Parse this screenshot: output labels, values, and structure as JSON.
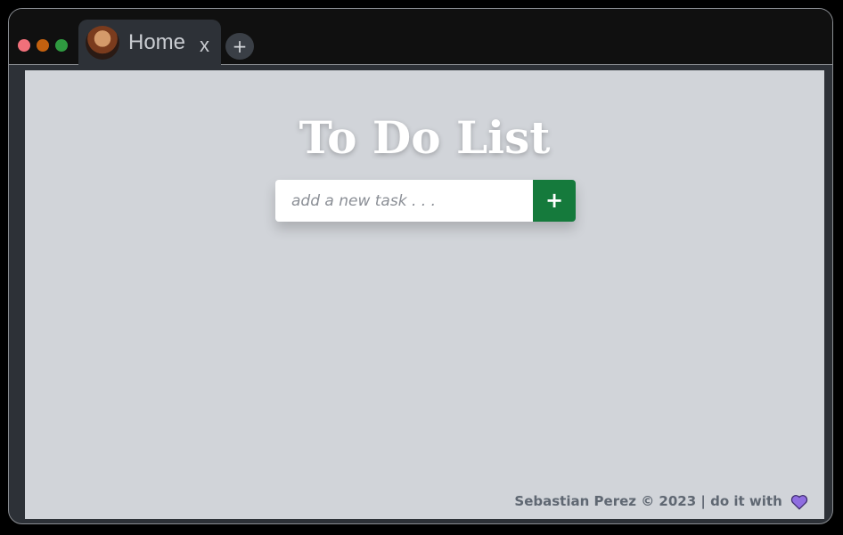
{
  "window": {
    "controls": [
      "close",
      "minimize",
      "maximize"
    ],
    "colors": {
      "close": "#f1707a",
      "minimize": "#c4610f",
      "maximize": "#2f9a40"
    }
  },
  "tab": {
    "label": "Home",
    "close_label": "x",
    "avatar_icon": "avatar-photo"
  },
  "new_tab": {
    "label": "+"
  },
  "main": {
    "title": "To Do List",
    "task_input": {
      "value": "",
      "placeholder": "add a new task . . ."
    },
    "add_button_label": "+"
  },
  "footer": {
    "text": "Sebastian Perez © 2023 | do it with",
    "icon": "heart-icon",
    "heart_color": "#8f6de0"
  },
  "colors": {
    "page_bg": "#d1d4d9",
    "frame": "#2d3137",
    "titlebar": "#101010",
    "accent": "#157a3c"
  }
}
